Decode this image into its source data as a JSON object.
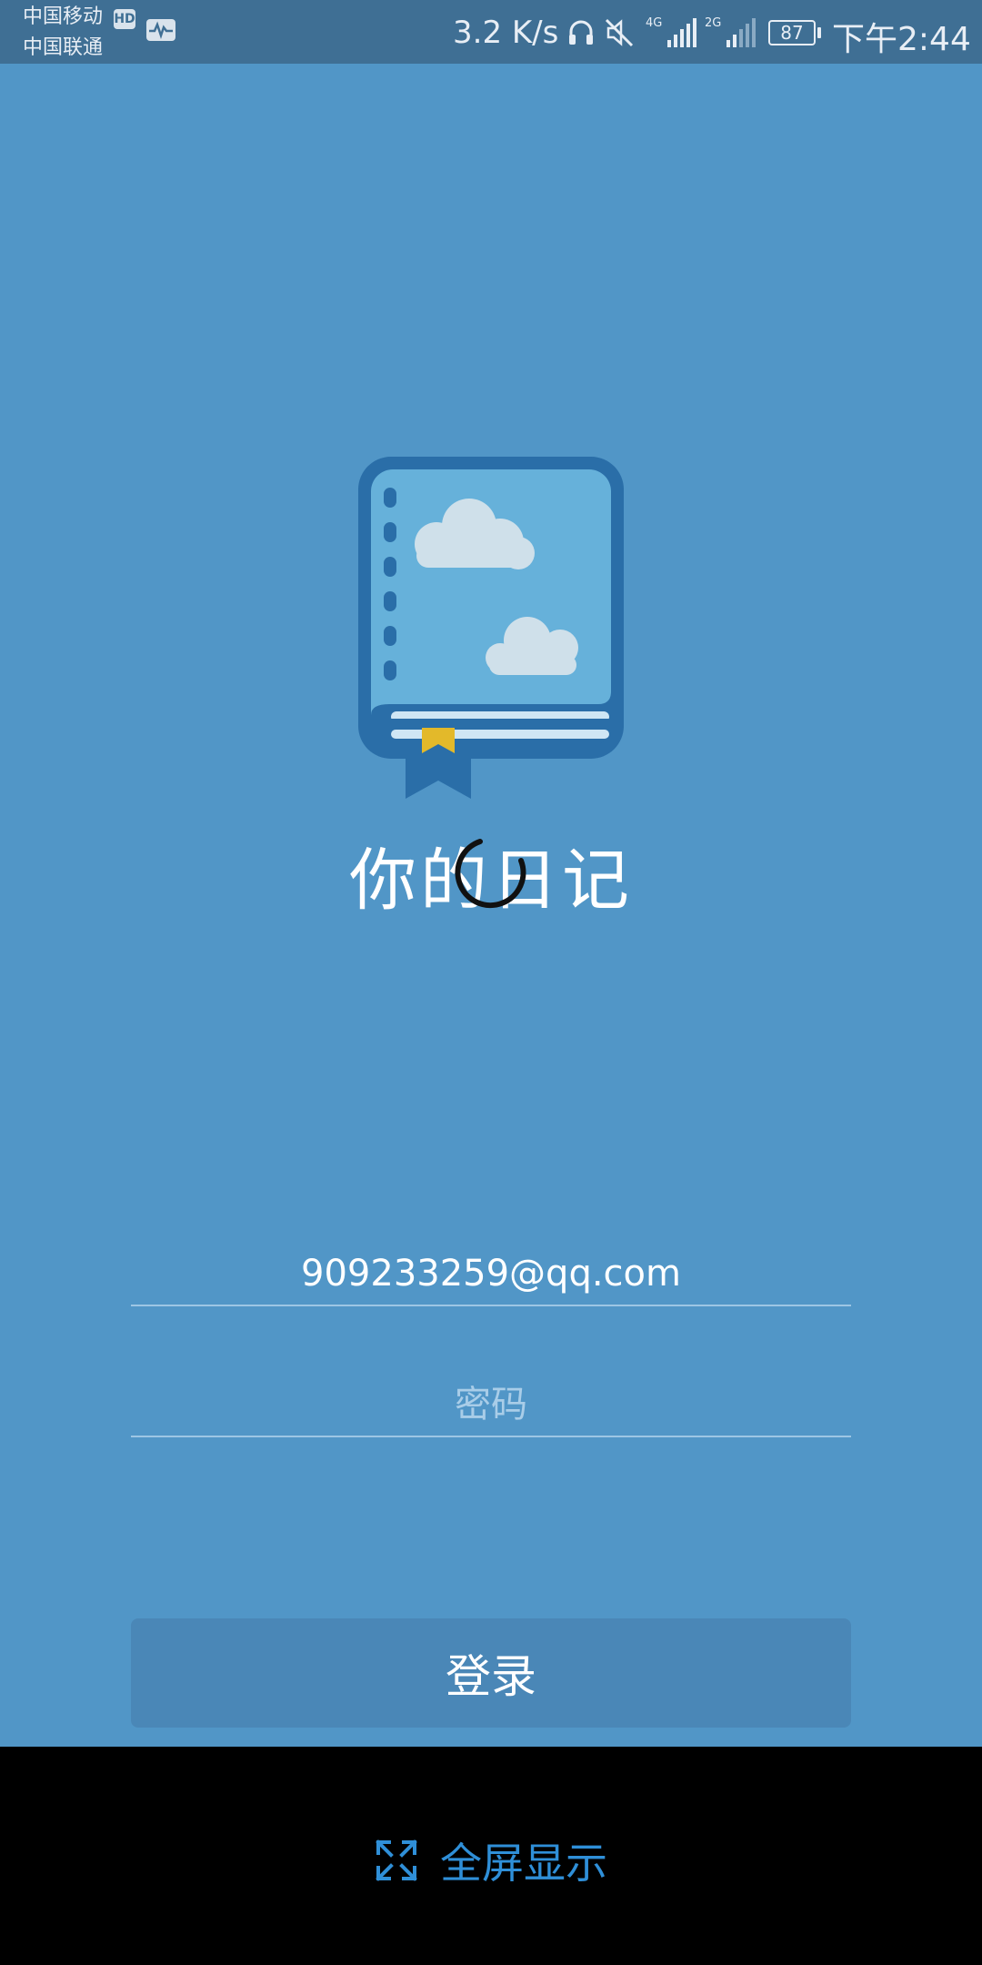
{
  "status_bar": {
    "carrier_1": "中国移动",
    "carrier_2": "中国联通",
    "hd_badge": "HD",
    "net_speed": "3.2 K/s",
    "network_1": "4G",
    "network_2": "2G",
    "battery": "87",
    "time": "下午2:44"
  },
  "app": {
    "title": "你的日记",
    "logo_icon": "diary-book-icon"
  },
  "form": {
    "email_value": "909233259@qq.com",
    "password_placeholder": "密码",
    "login_label": "登录"
  },
  "bottom_bar": {
    "fullscreen_label": "全屏显示",
    "fullscreen_icon": "expand-arrows-icon"
  },
  "colors": {
    "background": "#5196c7",
    "button": "#4a87b7",
    "accent": "#2f8fd8"
  }
}
